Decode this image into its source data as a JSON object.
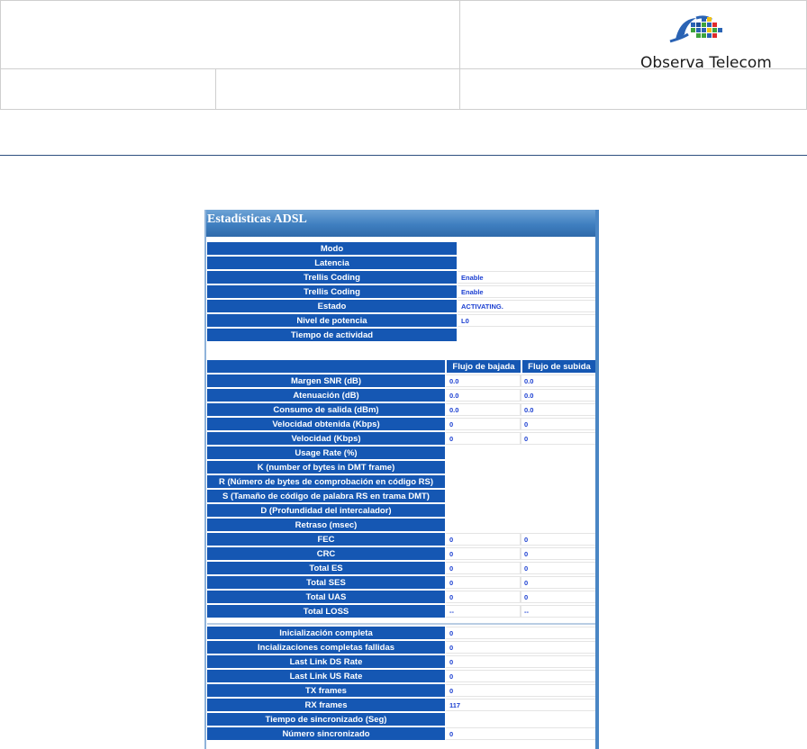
{
  "brand": {
    "name": "Observa Telecom"
  },
  "panel": {
    "title": "Estadísticas ADSL"
  },
  "general": [
    {
      "label": "Modo",
      "value": ""
    },
    {
      "label": "Latencia",
      "value": ""
    },
    {
      "label": "Trellis Coding",
      "value": "Enable"
    },
    {
      "label": "Trellis Coding",
      "value": "Enable"
    },
    {
      "label": "Estado",
      "value": "ACTIVATING."
    },
    {
      "label": "Nivel de potencia",
      "value": "L0"
    },
    {
      "label": "Tiempo de actividad",
      "value": ""
    }
  ],
  "stats": {
    "headers": {
      "down": "Flujo de bajada",
      "up": "Flujo de subida"
    },
    "rows": [
      {
        "label": "Margen SNR (dB)",
        "down": "0.0",
        "up": "0.0"
      },
      {
        "label": "Atenuación (dB)",
        "down": "0.0",
        "up": "0.0"
      },
      {
        "label": "Consumo de salida (dBm)",
        "down": "0.0",
        "up": "0.0"
      },
      {
        "label": "Velocidad obtenida (Kbps)",
        "down": "0",
        "up": "0"
      },
      {
        "label": "Velocidad (Kbps)",
        "down": "0",
        "up": "0"
      },
      {
        "label": "Usage Rate (%)",
        "down": "",
        "up": ""
      },
      {
        "label": "K (number of bytes in DMT frame)",
        "down": "",
        "up": ""
      },
      {
        "label": "R (Número de bytes de comprobación en código RS)",
        "down": "",
        "up": ""
      },
      {
        "label": "S (Tamaño de código de palabra RS en trama DMT)",
        "down": "",
        "up": ""
      },
      {
        "label": "D (Profundidad del intercalador)",
        "down": "",
        "up": ""
      },
      {
        "label": "Retraso (msec)",
        "down": "",
        "up": ""
      },
      {
        "label": "FEC",
        "down": "0",
        "up": "0"
      },
      {
        "label": "CRC",
        "down": "0",
        "up": "0"
      },
      {
        "label": "Total ES",
        "down": "0",
        "up": "0"
      },
      {
        "label": "Total SES",
        "down": "0",
        "up": "0"
      },
      {
        "label": "Total UAS",
        "down": "0",
        "up": "0"
      },
      {
        "label": "Total LOSS",
        "down": "--",
        "up": "--"
      }
    ]
  },
  "link": [
    {
      "label": "Inicialización completa",
      "value": "0"
    },
    {
      "label": "Incializaciones completas fallidas",
      "value": "0"
    },
    {
      "label": "Last Link DS Rate",
      "value": "0"
    },
    {
      "label": "Last Link US Rate",
      "value": "0"
    },
    {
      "label": "TX frames",
      "value": "0"
    },
    {
      "label": "RX frames",
      "value": "117"
    },
    {
      "label": "Tiempo de sincronizado (Seg)",
      "value": ""
    },
    {
      "label": "Número sincronizado",
      "value": "0"
    }
  ]
}
